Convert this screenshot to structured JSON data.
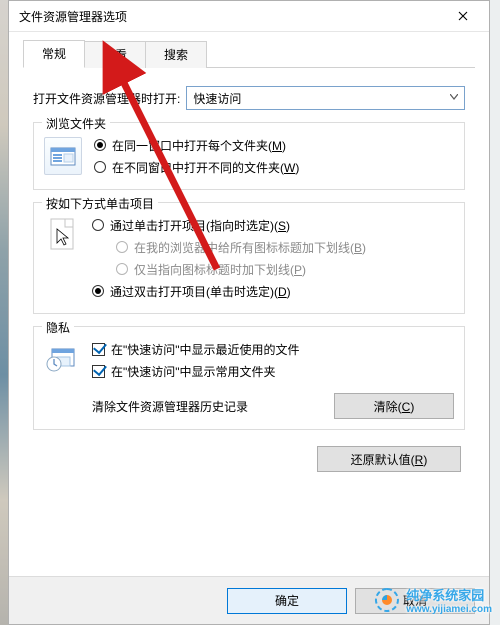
{
  "window": {
    "title": "文件资源管理器选项"
  },
  "tabs": {
    "general": "常规",
    "view": "查看",
    "search": "搜索"
  },
  "open": {
    "label": "打开文件资源管理器时打开:",
    "value": "快速访问"
  },
  "browse": {
    "legend": "浏览文件夹",
    "opt1_pre": "在同一窗口中打开每个文件夹(",
    "opt1_key": "M",
    "opt1_post": ")",
    "opt2_pre": "在不同窗口中打开不同的文件夹(",
    "opt2_key": "W",
    "opt2_post": ")"
  },
  "click": {
    "legend": "按如下方式单击项目",
    "opt1_pre": "通过单击打开项目(指向时选定)(",
    "opt1_key": "S",
    "opt1_post": ")",
    "sub1_pre": "在我的浏览器中给所有图标标题加下划线(",
    "sub1_key": "B",
    "sub1_post": ")",
    "sub2_pre": "仅当指向图标标题时加下划线(",
    "sub2_key": "P",
    "sub2_post": ")",
    "opt2_pre": "通过双击打开项目(单击时选定)(",
    "opt2_key": "D",
    "opt2_post": ")"
  },
  "privacy": {
    "legend": "隐私",
    "chk1": "在\"快速访问\"中显示最近使用的文件",
    "chk2": "在\"快速访问\"中显示常用文件夹",
    "clear_label": "清除文件资源管理器历史记录",
    "clear_btn_pre": "清除(",
    "clear_btn_key": "C",
    "clear_btn_post": ")"
  },
  "restore_pre": "还原默认值(",
  "restore_key": "R",
  "restore_post": ")",
  "ok": "确定",
  "cancel": "取消",
  "watermark_text": "纯净系统家园",
  "watermark_url": "www.yijiamei.com"
}
